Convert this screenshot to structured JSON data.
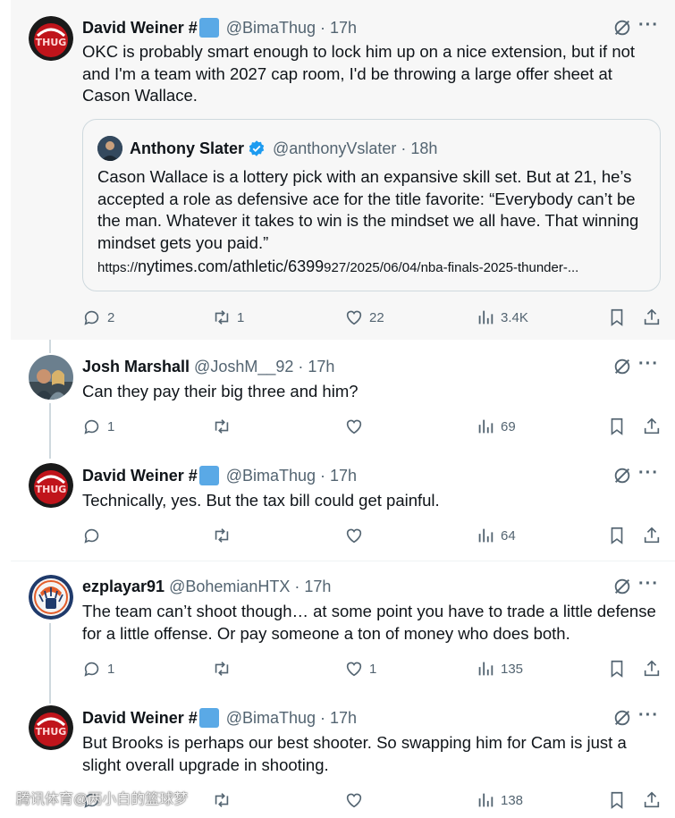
{
  "colors": {
    "muted": "#536471",
    "verified": "#1d9bf0",
    "highlight": "#f7f7f7",
    "border": "#cfd9de"
  },
  "tweets": [
    {
      "name": "David Weiner #",
      "handle": "@BimaThug",
      "time": "17h",
      "text": "OKC is probably smart enough to lock him up on a nice extension, but if not and I'm a team with 2027 cap room, I'd be throwing a large offer sheet at Cason Wallace.",
      "quote": {
        "name": "Anthony Slater",
        "handle": "@anthonyVslater",
        "time": "18h",
        "text": "Cason Wallace is a lottery pick with an expansive skill set. But at 21, he’s accepted a role as defensive ace for the title favorite: “Everybody can’t be the man. Whatever it takes to win is the mindset we all have. That winning mindset gets you paid.”",
        "link_prefix": "https://",
        "link_main": "nytimes.com/athletic/6399",
        "link_rest": "927/2025/06/04/nba-finals-2025-thunder-..."
      },
      "replies": "2",
      "retweets": "1",
      "likes": "22",
      "views": "3.4K"
    },
    {
      "name": "Josh Marshall",
      "handle": "@JoshM__92",
      "time": "17h",
      "text": "Can they pay their big three and him?",
      "replies": "1",
      "retweets": "",
      "likes": "",
      "views": "69"
    },
    {
      "name": "David Weiner #",
      "handle": "@BimaThug",
      "time": "17h",
      "text": "Technically, yes. But the tax bill could get painful.",
      "replies": "",
      "retweets": "",
      "likes": "",
      "views": "64"
    },
    {
      "name": "ezplayar91",
      "handle": "@BohemianHTX",
      "time": "17h",
      "text": "The team can’t shoot though… at some point you have to trade a little defense for a little offense. Or pay someone a ton of money who does both.",
      "replies": "1",
      "retweets": "",
      "likes": "1",
      "views": "135"
    },
    {
      "name": "David Weiner #",
      "handle": "@BimaThug",
      "time": "17h",
      "text": "But Brooks is perhaps our best shooter. So swapping him for Cam is just a slight overall upgrade in shooting.",
      "replies": "",
      "retweets": "",
      "likes": "",
      "views": "138"
    }
  ],
  "watermark": "腾讯体育@两小白的篮球梦"
}
